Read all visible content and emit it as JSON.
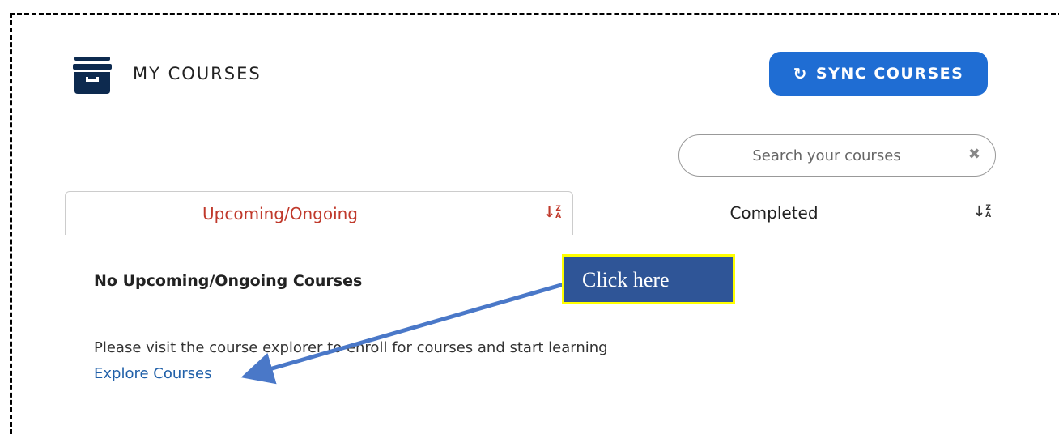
{
  "header": {
    "title": "MY COURSES",
    "icon": "archive-box-icon",
    "icon_color": "#0d2a4f"
  },
  "sync_button": {
    "label": "SYNC COURSES",
    "icon": "sync-icon",
    "color": "#1f6dd3"
  },
  "search": {
    "placeholder": "Search your courses",
    "value": "",
    "clear_icon": "close-icon"
  },
  "tabs": [
    {
      "label": "Upcoming/Ongoing",
      "active": true,
      "sort_icon": "sort-za-icon",
      "color": "#c0392b"
    },
    {
      "label": "Completed",
      "active": false,
      "sort_icon": "sort-za-icon"
    }
  ],
  "sort_icon_glyph": {
    "top": "Z",
    "bottom": "A"
  },
  "empty_state": {
    "heading": "No Upcoming/Ongoing Courses",
    "message": "Please visit the course explorer to enroll for courses and start learning",
    "link_label": "Explore Courses",
    "link_color": "#1f5fa8"
  },
  "annotation": {
    "callout_text": "Click here",
    "callout_bg": "#2f5597",
    "callout_border": "#ffff00",
    "arrow_color": "#4a78c8"
  }
}
